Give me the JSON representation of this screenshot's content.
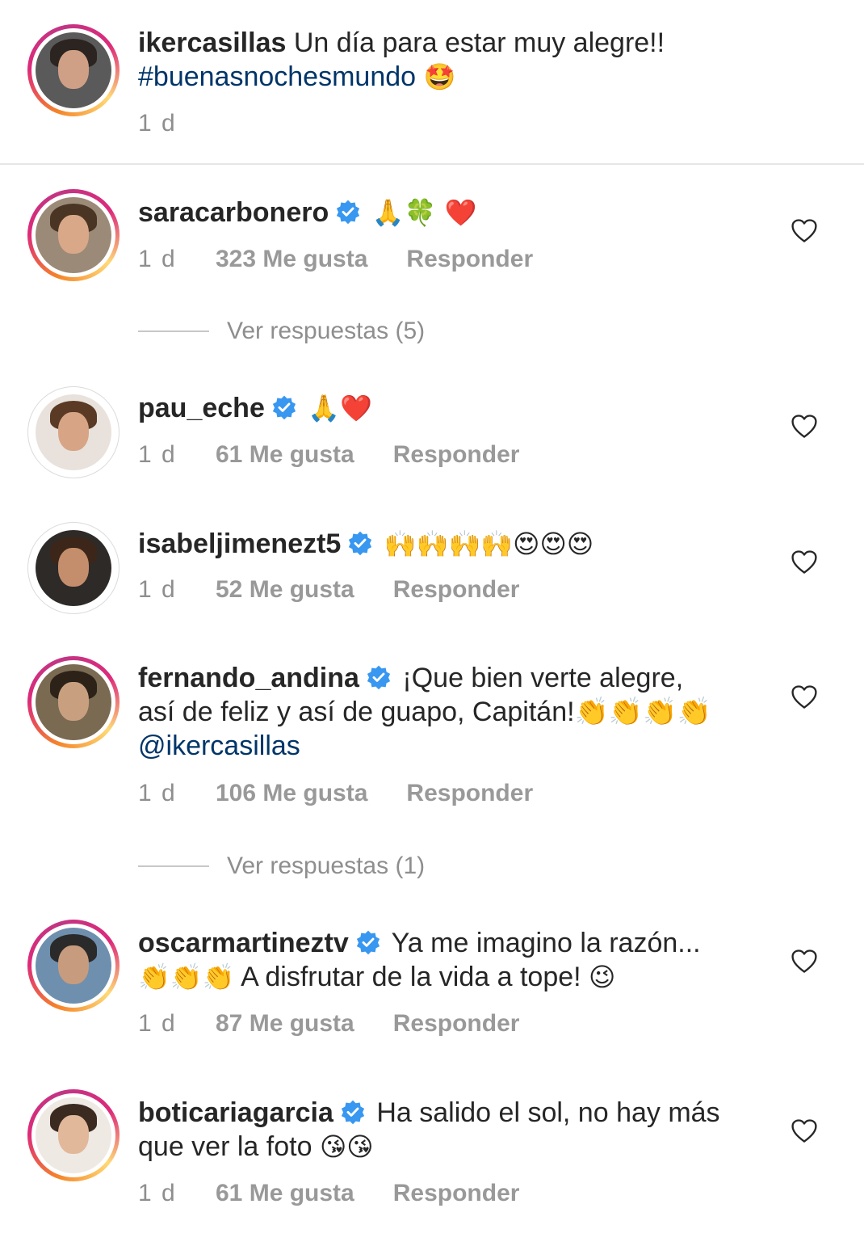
{
  "caption": {
    "username": "ikercasillas",
    "text": "Un día para estar muy alegre!!",
    "hashtag": "#buenasnochesmundo",
    "emoji": "🤩",
    "time": "1 d"
  },
  "comments": [
    {
      "username": "saracarbonero",
      "verified": true,
      "text": "🙏🍀 ❤️",
      "time": "1 d",
      "likes": "323 Me gusta",
      "reply": "Responder",
      "replies": "Ver respuestas (5)"
    },
    {
      "username": "pau_eche",
      "verified": true,
      "text": "🙏❤️",
      "time": "1 d",
      "likes": "61 Me gusta",
      "reply": "Responder"
    },
    {
      "username": "isabeljimenezt5",
      "verified": true,
      "text": "🙌🙌🙌🙌😍😍😍",
      "time": "1 d",
      "likes": "52 Me gusta",
      "reply": "Responder"
    },
    {
      "username": "fernando_andina",
      "verified": true,
      "text_line1": "¡Que bien verte alegre,",
      "text_line2": "así de feliz y así de guapo, Capitán!👏👏👏👏",
      "mention": "@ikercasillas",
      "time": "1 d",
      "likes": "106 Me gusta",
      "reply": "Responder",
      "replies": "Ver respuestas (1)"
    },
    {
      "username": "oscarmartineztv",
      "verified": true,
      "text_line1": "Ya me imagino la razón...",
      "text_line2_emoji": "👏👏👏",
      "text_line2": "A disfrutar de la vida a tope!",
      "text_line2_end": "😉",
      "time": "1 d",
      "likes": "87 Me gusta",
      "reply": "Responder"
    },
    {
      "username": "boticariagarcia",
      "verified": true,
      "text_line1": "Ha salido el sol, no hay más",
      "text_line2": "que ver la foto",
      "text_line2_emoji": "😘😘",
      "time": "1 d",
      "likes": "61 Me gusta",
      "reply": "Responder"
    }
  ],
  "colors": {
    "link": "#003569",
    "verified": "#3897f0",
    "meta": "#8e8e8e"
  },
  "icons": [
    "verified-badge-icon",
    "heart-outline-icon"
  ]
}
